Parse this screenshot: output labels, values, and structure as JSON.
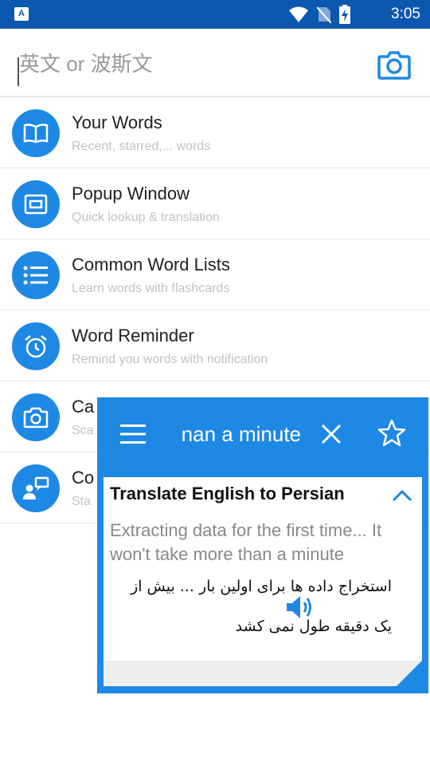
{
  "status_bar": {
    "app_icon_letter": "A",
    "time": "3:05",
    "icons": [
      "wifi-icon",
      "no-sim-icon",
      "battery-charging-icon"
    ]
  },
  "search": {
    "placeholder": "英文 or 波斯文",
    "value": "",
    "camera_icon": "camera-icon"
  },
  "menu": {
    "items": [
      {
        "icon": "book-icon",
        "title": "Your Words",
        "subtitle": "Recent, starred,... words"
      },
      {
        "icon": "popup-window-icon",
        "title": "Popup Window",
        "subtitle": "Quick lookup & translation"
      },
      {
        "icon": "list-icon",
        "title": "Common Word Lists",
        "subtitle": "Learn words with flashcards"
      },
      {
        "icon": "alarm-clock-icon",
        "title": "Word Reminder",
        "subtitle": "Remind you words with notification"
      },
      {
        "icon": "camera-icon",
        "title": "Ca",
        "subtitle": "Sca"
      },
      {
        "icon": "conversation-icon",
        "title": "Co",
        "subtitle": "Sta"
      }
    ]
  },
  "popup": {
    "query": "nan a minute",
    "title": "Translate English to Persian",
    "source_text": "Extracting data for the first time... It won't take more than a minute",
    "target_text": "استخراج داده ها برای اولین بار ... بیش از یک دقیقه طول نمی کشد"
  },
  "colors": {
    "status_bar": "#0c57b0",
    "accent": "#1e88e5",
    "title_text": "#202020",
    "subtitle_text": "#c2c2c2"
  }
}
